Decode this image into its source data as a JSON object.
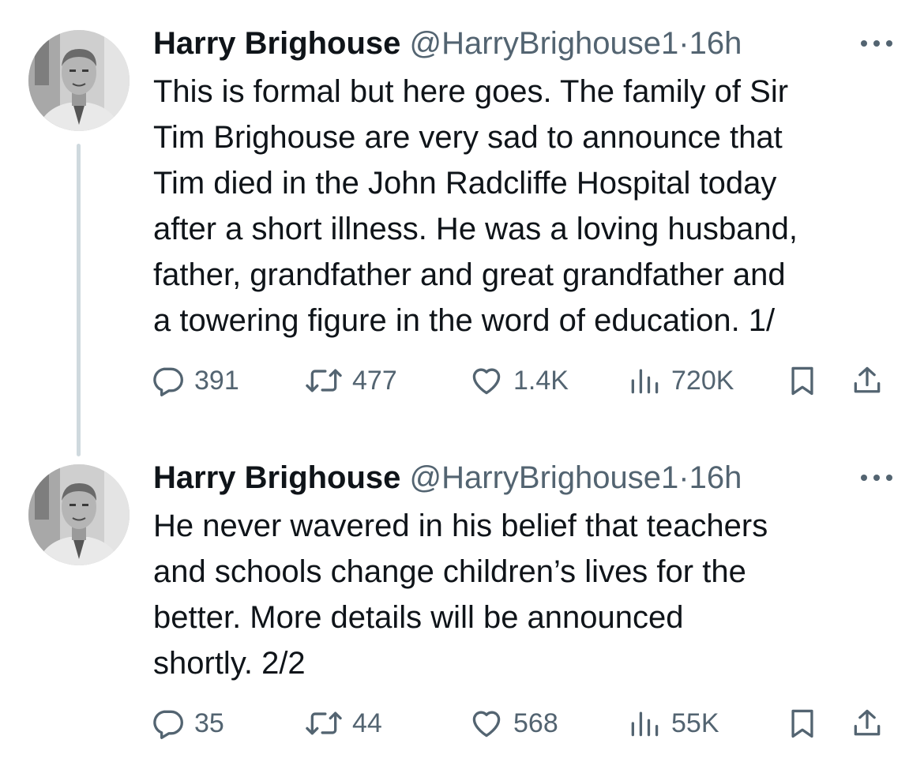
{
  "tweets": [
    {
      "author": {
        "name": "Harry Brighouse",
        "handle": "@HarryBrighouse1",
        "separator": "·",
        "time": "16h"
      },
      "text": "This is formal but here goes. The family of Sir\nTim Brighouse are very sad to announce that\nTim died in the John Radcliffe Hospital today\nafter a short illness. He was a loving husband,\nfather, grandfather and great grandfather and\na towering figure in the word of education. 1/",
      "stats": {
        "replies": "391",
        "reposts": "477",
        "likes": "1.4K",
        "views": "720K"
      }
    },
    {
      "author": {
        "name": "Harry Brighouse",
        "handle": "@HarryBrighouse1",
        "separator": "·",
        "time": "16h"
      },
      "text": "He never wavered in his belief that teachers\nand schools change children’s lives for the\nbetter. More details will be announced\nshortly. 2/2",
      "stats": {
        "replies": "35",
        "reposts": "44",
        "likes": "568",
        "views": "55K"
      }
    }
  ],
  "icons": {
    "more": "more-horizontal-icon",
    "reply": "reply-bubble-icon",
    "repost": "repost-arrows-icon",
    "like": "heart-icon",
    "views": "views-bar-chart-icon",
    "bookmark": "bookmark-icon",
    "share": "share-upload-icon"
  },
  "colors": {
    "text": "#0f1419",
    "secondary": "#536471",
    "thread_line": "#cfd9de",
    "background": "#ffffff"
  }
}
